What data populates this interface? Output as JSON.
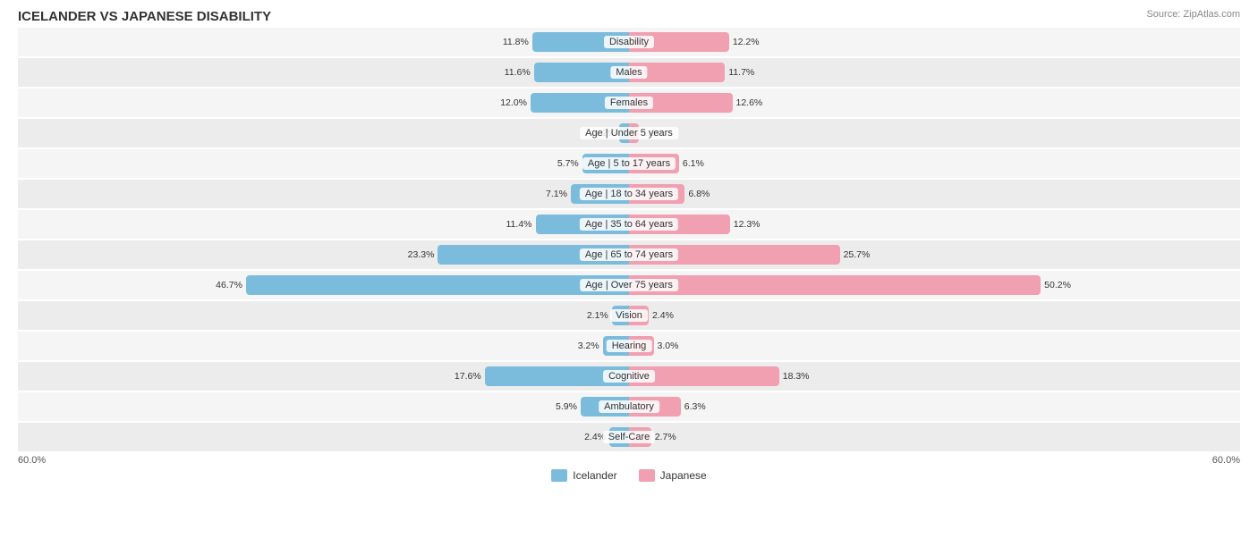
{
  "title": "ICELANDER VS JAPANESE DISABILITY",
  "source": "Source: ZipAtlas.com",
  "axis_min": "60.0%",
  "axis_max": "60.0%",
  "legend": {
    "icelander_label": "Icelander",
    "japanese_label": "Japanese",
    "icelander_color": "#7bbcdc",
    "japanese_color": "#f0a0b0"
  },
  "rows": [
    {
      "label": "Disability",
      "left_val": "11.8%",
      "left_pct": 11.8,
      "right_val": "12.2%",
      "right_pct": 12.2
    },
    {
      "label": "Males",
      "left_val": "11.6%",
      "left_pct": 11.6,
      "right_val": "11.7%",
      "right_pct": 11.7
    },
    {
      "label": "Females",
      "left_val": "12.0%",
      "left_pct": 12.0,
      "right_val": "12.6%",
      "right_pct": 12.6
    },
    {
      "label": "Age | Under 5 years",
      "left_val": "1.2%",
      "left_pct": 1.2,
      "right_val": "1.2%",
      "right_pct": 1.2
    },
    {
      "label": "Age | 5 to 17 years",
      "left_val": "5.7%",
      "left_pct": 5.7,
      "right_val": "6.1%",
      "right_pct": 6.1
    },
    {
      "label": "Age | 18 to 34 years",
      "left_val": "7.1%",
      "left_pct": 7.1,
      "right_val": "6.8%",
      "right_pct": 6.8
    },
    {
      "label": "Age | 35 to 64 years",
      "left_val": "11.4%",
      "left_pct": 11.4,
      "right_val": "12.3%",
      "right_pct": 12.3
    },
    {
      "label": "Age | 65 to 74 years",
      "left_val": "23.3%",
      "left_pct": 23.3,
      "right_val": "25.7%",
      "right_pct": 25.7
    },
    {
      "label": "Age | Over 75 years",
      "left_val": "46.7%",
      "left_pct": 46.7,
      "right_val": "50.2%",
      "right_pct": 50.2
    },
    {
      "label": "Vision",
      "left_val": "2.1%",
      "left_pct": 2.1,
      "right_val": "2.4%",
      "right_pct": 2.4
    },
    {
      "label": "Hearing",
      "left_val": "3.2%",
      "left_pct": 3.2,
      "right_val": "3.0%",
      "right_pct": 3.0
    },
    {
      "label": "Cognitive",
      "left_val": "17.6%",
      "left_pct": 17.6,
      "right_val": "18.3%",
      "right_pct": 18.3
    },
    {
      "label": "Ambulatory",
      "left_val": "5.9%",
      "left_pct": 5.9,
      "right_val": "6.3%",
      "right_pct": 6.3
    },
    {
      "label": "Self-Care",
      "left_val": "2.4%",
      "left_pct": 2.4,
      "right_val": "2.7%",
      "right_pct": 2.7
    }
  ],
  "max_pct": 60
}
